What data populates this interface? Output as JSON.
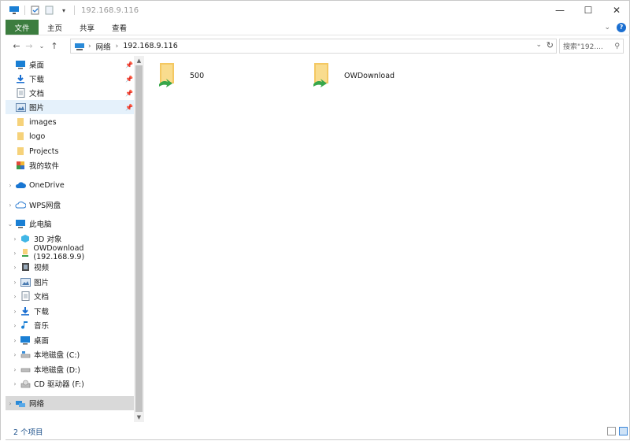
{
  "window": {
    "title": "192.168.9.116"
  },
  "ribbon": {
    "tabs": [
      {
        "label": "文件"
      },
      {
        "label": "主页"
      },
      {
        "label": "共享"
      },
      {
        "label": "查看"
      }
    ]
  },
  "address": {
    "crumbs": [
      {
        "label": "网络"
      },
      {
        "label": "192.168.9.116"
      }
    ]
  },
  "search": {
    "placeholder": "搜索\"192...."
  },
  "navpane": {
    "quick": [
      {
        "label": "桌面",
        "icon": "desktop-icon",
        "pinned": true
      },
      {
        "label": "下载",
        "icon": "download-icon",
        "pinned": true
      },
      {
        "label": "文档",
        "icon": "document-icon",
        "pinned": true
      },
      {
        "label": "图片",
        "icon": "picture-icon",
        "pinned": true
      },
      {
        "label": "images",
        "icon": "folder-icon"
      },
      {
        "label": "logo",
        "icon": "folder-icon"
      },
      {
        "label": "Projects",
        "icon": "folder-icon"
      },
      {
        "label": "我的软件",
        "icon": "app-icon"
      }
    ],
    "onedrive": {
      "label": "OneDrive"
    },
    "wps": {
      "label": "WPS网盘"
    },
    "thispc": {
      "label": "此电脑",
      "children": [
        {
          "label": "3D 对象",
          "icon": "cube-icon"
        },
        {
          "label": "OWDownload (192.168.9.9)",
          "icon": "network-drive-icon"
        },
        {
          "label": "视频",
          "icon": "video-icon"
        },
        {
          "label": "图片",
          "icon": "picture-icon"
        },
        {
          "label": "文档",
          "icon": "document-icon"
        },
        {
          "label": "下载",
          "icon": "download-icon"
        },
        {
          "label": "音乐",
          "icon": "music-icon"
        },
        {
          "label": "桌面",
          "icon": "desktop-icon"
        },
        {
          "label": "本地磁盘 (C:)",
          "icon": "disk-icon"
        },
        {
          "label": "本地磁盘 (D:)",
          "icon": "disk-icon"
        },
        {
          "label": "CD 驱动器 (F:)",
          "icon": "cd-icon"
        }
      ]
    },
    "network": {
      "label": "网络"
    }
  },
  "content": {
    "items": [
      {
        "label": "500"
      },
      {
        "label": "OWDownload"
      }
    ]
  },
  "status": {
    "count": "2 个项目"
  }
}
